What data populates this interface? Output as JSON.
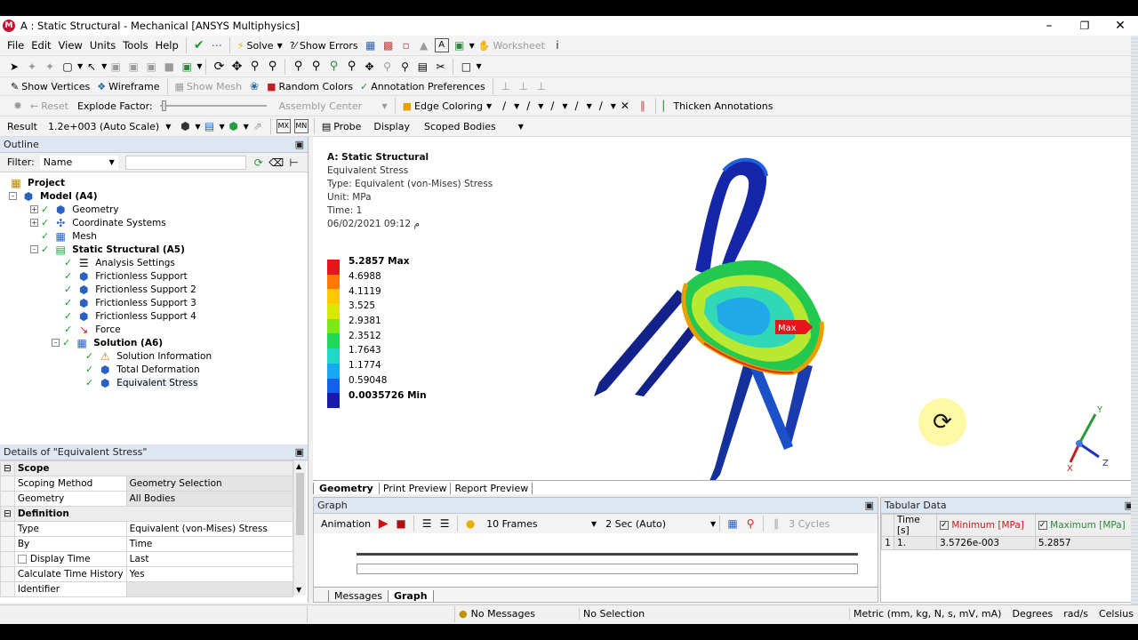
{
  "window": {
    "title": "A : Static Structural - Mechanical [ANSYS Multiphysics]",
    "app_icon": "M"
  },
  "menu": [
    "File",
    "Edit",
    "View",
    "Units",
    "Tools",
    "Help"
  ],
  "toolbar1": {
    "solve": "Solve",
    "show_errors": "?⁄ Show Errors",
    "worksheet": "Worksheet"
  },
  "toolbar3": {
    "show_vertices": "Show Vertices",
    "wireframe": "Wireframe",
    "show_mesh": "Show Mesh",
    "random_colors": "Random Colors",
    "annotation_preferences": "Annotation Preferences"
  },
  "toolbar4": {
    "reset": "Reset",
    "explode_factor": "Explode Factor:",
    "assembly_center": "Assembly Center",
    "edge_coloring": "Edge Coloring",
    "thicken_annotations": "Thicken Annotations"
  },
  "toolbar5": {
    "result_label": "Result",
    "scale": "1.2e+003 (Auto Scale)",
    "probe": "Probe",
    "display_label": "Display",
    "display_value": "Scoped Bodies"
  },
  "outline": {
    "title": "Outline",
    "filter_label": "Filter:",
    "filter_value": "Name",
    "items": [
      "Project",
      "Model (A4)",
      "Geometry",
      "Coordinate Systems",
      "Mesh",
      "Static Structural (A5)",
      "Analysis Settings",
      "Frictionless Support",
      "Frictionless Support 2",
      "Frictionless Support 3",
      "Frictionless Support 4",
      "Force",
      "Solution (A6)",
      "Solution Information",
      "Total Deformation",
      "Equivalent Stress"
    ]
  },
  "details": {
    "title": "Details of \"Equivalent Stress\"",
    "sections": {
      "scope": "Scope",
      "definition": "Definition"
    },
    "rows": [
      {
        "k": "Scoping Method",
        "v": "Geometry Selection"
      },
      {
        "k": "Geometry",
        "v": "All Bodies"
      },
      {
        "k": "Type",
        "v": "Equivalent (von-Mises) Stress"
      },
      {
        "k": "By",
        "v": "Time"
      },
      {
        "k": "Display Time",
        "v": "Last"
      },
      {
        "k": "Calculate Time History",
        "v": "Yes"
      },
      {
        "k": "Identifier",
        "v": ""
      }
    ]
  },
  "viewport": {
    "info": [
      "A: Static Structural",
      "Equivalent Stress",
      "Type: Equivalent (von-Mises) Stress",
      "Unit: MPa",
      "Time: 1",
      "06/02/2021 09:12 م"
    ],
    "legend": [
      "5.2857 Max",
      "4.6988",
      "4.1119",
      "3.525",
      "2.9381",
      "2.3512",
      "1.7643",
      "1.1774",
      "0.59048",
      "0.0035726 Min"
    ],
    "legend_colors": [
      "#e8141c",
      "#ff7a00",
      "#ffc800",
      "#d8e800",
      "#7ce818",
      "#22d85a",
      "#1ed8c8",
      "#1aa8f0",
      "#1560e8",
      "#1a1aa8"
    ],
    "max_label": "Max",
    "tabs": [
      "Geometry",
      "Print Preview",
      "Report Preview"
    ],
    "axes": {
      "x": "X",
      "y": "Y",
      "z": "Z"
    }
  },
  "graph": {
    "title": "Graph",
    "animation": "Animation",
    "frames": "10 Frames",
    "duration": "2 Sec (Auto)",
    "cycles": "3 Cycles",
    "tabs": [
      "Messages",
      "Graph"
    ]
  },
  "tabular": {
    "title": "Tabular Data",
    "headers": [
      "Time [s]",
      "Minimum [MPa]",
      "Maximum [MPa]"
    ],
    "rows": [
      {
        "idx": "1",
        "time": "1.",
        "min": "3.5726e-003",
        "max": "5.2857"
      }
    ]
  },
  "status": {
    "messages": "No Messages",
    "selection": "No Selection",
    "units": "Metric (mm, kg, N, s, mV, mA)",
    "angle": "Degrees",
    "rate": "rad/s",
    "temp": "Celsius"
  }
}
